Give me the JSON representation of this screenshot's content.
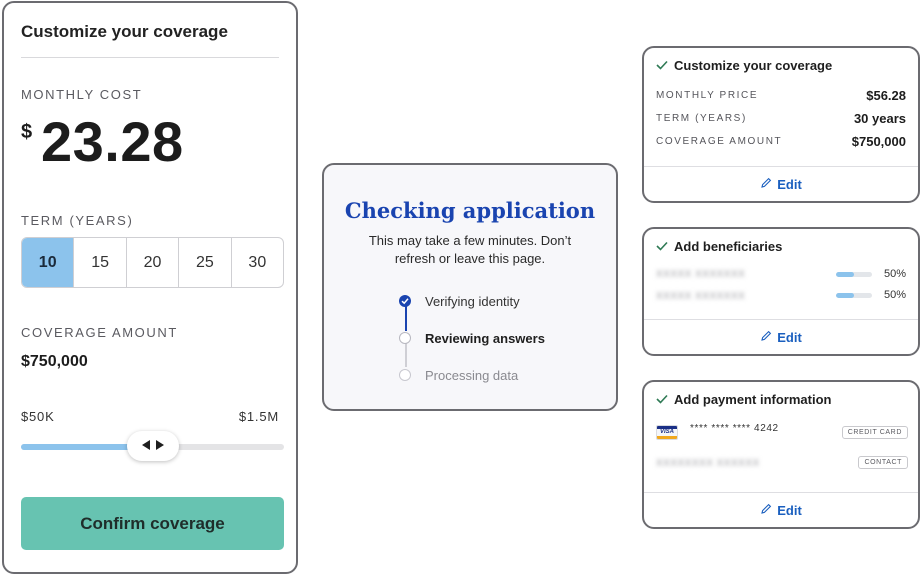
{
  "left_panel": {
    "title": "Customize your coverage",
    "monthly_cost_label": "MONTHLY COST",
    "currency": "$",
    "monthly_cost": "23.28",
    "term_label": "TERM (YEARS)",
    "term_options": [
      "10",
      "15",
      "20",
      "25",
      "30"
    ],
    "term_selected": "10",
    "coverage_label": "COVERAGE AMOUNT",
    "coverage_value": "$750,000",
    "range_min": "$50K",
    "range_max": "$1.5M",
    "slider_fraction": 0.5,
    "confirm_label": "Confirm coverage"
  },
  "status_panel": {
    "title": "Checking application",
    "subtitle": "This may take a few minutes. Don’t refresh or leave this page.",
    "steps": [
      {
        "label": "Verifying identity",
        "state": "done"
      },
      {
        "label": "Reviewing answers",
        "state": "active"
      },
      {
        "label": "Processing data",
        "state": "pending"
      }
    ]
  },
  "summary_cards": {
    "coverage": {
      "title": "Customize your coverage",
      "rows": [
        {
          "label": "MONTHLY PRICE",
          "value": "$56.28"
        },
        {
          "label": "TERM (YEARS)",
          "value": "30 years"
        },
        {
          "label": "COVERAGE AMOUNT",
          "value": "$750,000"
        }
      ],
      "edit_label": "Edit"
    },
    "beneficiaries": {
      "title": "Add beneficiaries",
      "rows": [
        {
          "name": "XXXXX XXXXXXX",
          "share": "50%",
          "fraction": 0.5
        },
        {
          "name": "XXXXX XXXXXXX",
          "share": "50%",
          "fraction": 0.5
        }
      ],
      "edit_label": "Edit"
    },
    "payment": {
      "title": "Add payment information",
      "card_brand": "VISA",
      "card_number": "**** **** **** 4242",
      "card_tag": "CREDIT CARD",
      "account_text": "XXXXXXXX XXXXXX",
      "account_tag": "CONTACT",
      "edit_label": "Edit"
    }
  },
  "colors": {
    "accent_blue": "#8cc3ec",
    "confirm_green": "#67c3b1",
    "heading_blue": "#1a44b0",
    "link_blue": "#1a5fbf",
    "check_green": "#2f7a55"
  }
}
